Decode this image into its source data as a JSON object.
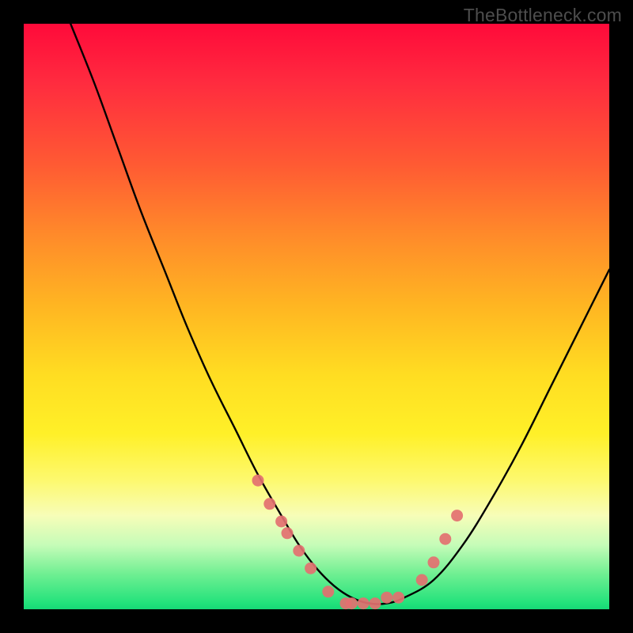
{
  "watermark_text": "TheBottleneck.com",
  "chart_data": {
    "type": "line",
    "title": "",
    "xlabel": "",
    "ylabel": "",
    "xlim": [
      0,
      100
    ],
    "ylim": [
      0,
      100
    ],
    "grid": false,
    "annotations": [
      "TheBottleneck.com"
    ],
    "series": [
      {
        "name": "curve",
        "style": "line",
        "color": "#000000",
        "x": [
          8,
          12,
          16,
          20,
          24,
          28,
          32,
          36,
          40,
          44,
          47,
          50,
          53,
          56,
          59,
          62,
          65,
          70,
          75,
          80,
          85,
          90,
          95,
          100
        ],
        "y": [
          100,
          90,
          79,
          68,
          58,
          48,
          39,
          31,
          23,
          16,
          11,
          7,
          4,
          2,
          1,
          1,
          2,
          5,
          11,
          19,
          28,
          38,
          48,
          58
        ]
      },
      {
        "name": "data-points",
        "style": "scatter",
        "color": "#e37070",
        "x": [
          40,
          42,
          44,
          45,
          47,
          49,
          52,
          55,
          56,
          58,
          60,
          62,
          64,
          68,
          70,
          72,
          74
        ],
        "y": [
          22,
          18,
          15,
          13,
          10,
          7,
          3,
          1,
          1,
          1,
          1,
          2,
          2,
          5,
          8,
          12,
          16
        ]
      }
    ]
  },
  "colors": {
    "curve_stroke": "#000000",
    "point_fill": "#e37070",
    "gradient_top": "#ff0a3a",
    "gradient_bottom": "#17d877",
    "frame_bg": "#000000"
  }
}
